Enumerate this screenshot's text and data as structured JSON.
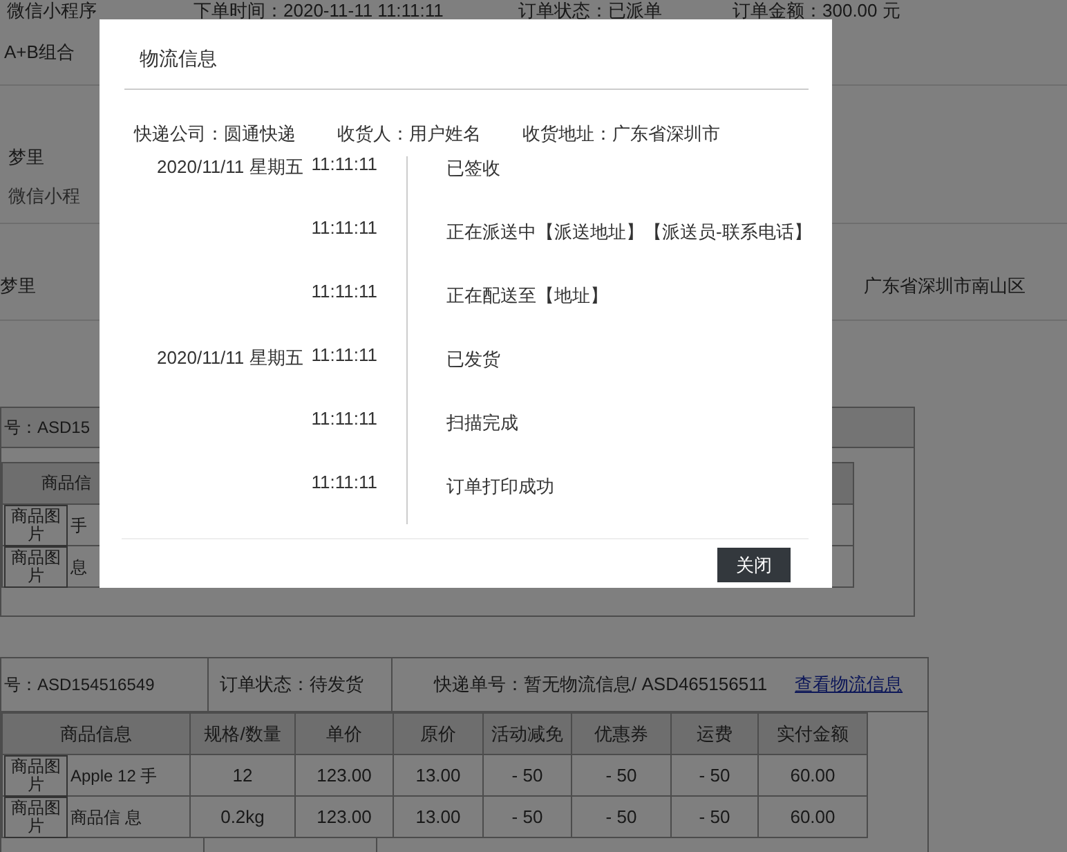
{
  "order_summary": [
    "微信小程序",
    "下单时间：2020-11-11 11:11:11",
    "订单状态：已派单",
    "订单金额：300.00 元"
  ],
  "bundle": "A+B组合",
  "buyer_rows": [
    {
      "name": "梦里",
      "source": "微信小程"
    },
    {
      "name": "梦里",
      "address": "广东省深圳市南山区"
    }
  ],
  "orders": [
    {
      "header": [
        {
          "text": "号：ASD15"
        }
      ],
      "columns": [
        "商品信"
      ],
      "rows": [
        {
          "cells": [
            {
              "image": "商品图片",
              "name": "手"
            }
          ]
        },
        {
          "cells": [
            {
              "image": "商品图片",
              "name": "息"
            }
          ]
        }
      ]
    },
    {
      "header": [
        {
          "text": "号：ASD154516549"
        },
        {
          "text": "订单状态：待发货"
        },
        {
          "text": "快递单号：暂无物流信息/ ASD465156511",
          "link": "查看物流信息"
        }
      ],
      "columns": [
        "商品信息",
        "规格/数量",
        "单价",
        "原价",
        "活动减免",
        "优惠券",
        "运费",
        "实付金额"
      ],
      "rows": [
        {
          "cells": [
            {
              "image": "商品图片",
              "name": "Apple 12 手"
            },
            "12",
            "123.00",
            "13.00",
            "- 50",
            "- 50",
            "- 50",
            "60.00"
          ]
        },
        {
          "cells": [
            {
              "image": "商品图片",
              "name": "商品信 息"
            },
            "0.2kg",
            "123.00",
            "13.00",
            "- 50",
            "- 50",
            "- 50",
            "60.00"
          ]
        }
      ]
    }
  ],
  "dialog": {
    "title": "物流信息",
    "info": [
      "快递公司：圆通快递",
      "收货人：用户姓名",
      "收货地址：广东省深圳市"
    ],
    "events": [
      {
        "date": "2020/11/11  星期五",
        "time": "11:11:11",
        "text": "已签收"
      },
      {
        "time": "11:11:11",
        "text": "正在派送中【派送地址】【派送员-联系电话】"
      },
      {
        "time": "11:11:11",
        "text": "正在配送至【地址】"
      },
      {
        "date": "2020/11/11  星期五",
        "time": "11:11:11",
        "text": "已发货"
      },
      {
        "time": "11:11:11",
        "text": "扫描完成"
      },
      {
        "time": "11:11:11",
        "text": "订单打印成功"
      }
    ],
    "button": "关闭"
  }
}
